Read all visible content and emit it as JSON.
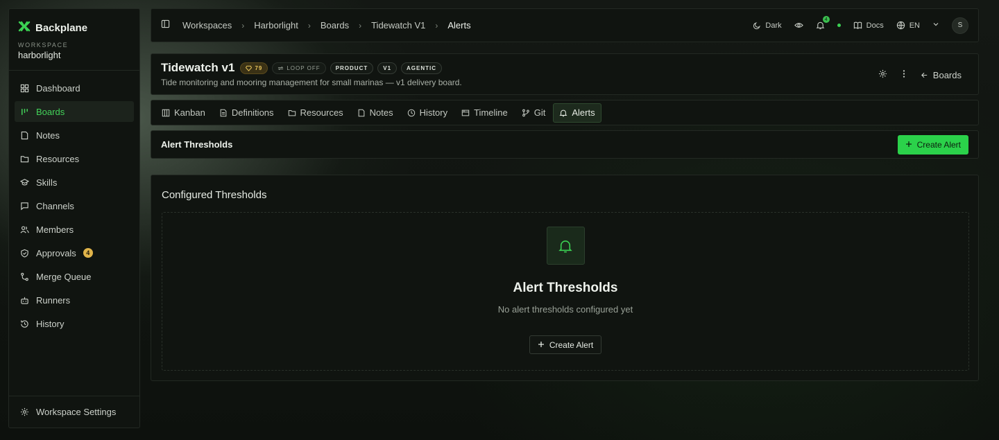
{
  "brand": {
    "name": "Backplane"
  },
  "workspace": {
    "caption": "WORKSPACE",
    "name": "harborlight"
  },
  "sidebar": {
    "items": [
      {
        "label": "Dashboard",
        "icon": "dashboard-icon"
      },
      {
        "label": "Boards",
        "icon": "boards-icon",
        "active": true
      },
      {
        "label": "Notes",
        "icon": "note-icon"
      },
      {
        "label": "Resources",
        "icon": "folder-icon"
      },
      {
        "label": "Skills",
        "icon": "skills-icon"
      },
      {
        "label": "Channels",
        "icon": "chat-icon"
      },
      {
        "label": "Members",
        "icon": "members-icon"
      },
      {
        "label": "Approvals",
        "icon": "shield-icon",
        "badge": "4"
      },
      {
        "label": "Merge Queue",
        "icon": "merge-icon"
      },
      {
        "label": "Runners",
        "icon": "bot-icon"
      },
      {
        "label": "History",
        "icon": "history-icon"
      }
    ],
    "settings_label": "Workspace Settings"
  },
  "topbar": {
    "breadcrumbs": [
      "Workspaces",
      "Harborlight",
      "Boards",
      "Tidewatch V1",
      "Alerts"
    ],
    "theme_label": "Dark",
    "notif_count": "4",
    "docs_label": "Docs",
    "lang_label": "EN",
    "avatar_initial": "S"
  },
  "board": {
    "title": "Tidewatch v1",
    "score": "79",
    "loop": "LOOP OFF",
    "tags": [
      "PRODUCT",
      "V1",
      "AGENTIC"
    ],
    "description": "Tide monitoring and mooring management for small marinas — v1 delivery board.",
    "back_label": "Boards"
  },
  "tabs": [
    {
      "label": "Kanban",
      "icon": "kanban-icon"
    },
    {
      "label": "Definitions",
      "icon": "document-icon"
    },
    {
      "label": "Resources",
      "icon": "folder-icon"
    },
    {
      "label": "Notes",
      "icon": "note-icon"
    },
    {
      "label": "History",
      "icon": "clock-icon"
    },
    {
      "label": "Timeline",
      "icon": "timeline-icon"
    },
    {
      "label": "Git",
      "icon": "git-branch-icon"
    },
    {
      "label": "Alerts",
      "icon": "bell-icon",
      "active": true
    }
  ],
  "alerts": {
    "bar_title": "Alert Thresholds",
    "create_label": "Create Alert",
    "card_title": "Configured Thresholds",
    "empty_title": "Alert Thresholds",
    "empty_sub": "No alert thresholds configured yet",
    "empty_button": "Create Alert"
  },
  "colors": {
    "accent": "#2bd14a",
    "amber": "#e0b44a",
    "panel": "#101410"
  }
}
